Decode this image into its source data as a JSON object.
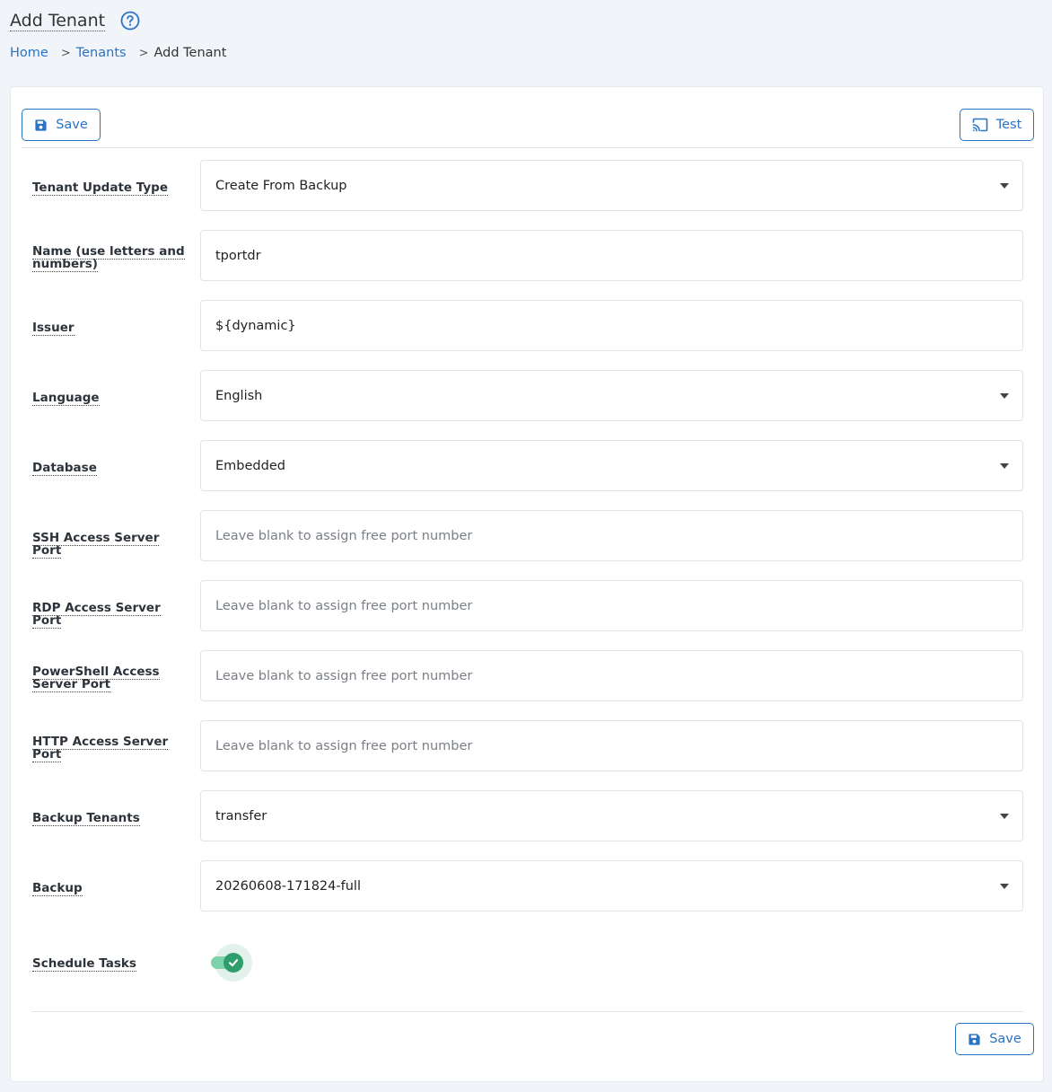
{
  "header": {
    "title": "Add Tenant",
    "help_icon": "question-circle-icon"
  },
  "breadcrumb": {
    "home": "Home",
    "sep": ">",
    "tenants": "Tenants",
    "current": "Add Tenant"
  },
  "toolbar": {
    "save_label": "Save",
    "test_label": "Test",
    "save_icon": "floppy-disk-icon",
    "test_icon": "cast-icon"
  },
  "form": {
    "tenant_update_type": {
      "label": "Tenant Update Type",
      "value": "Create From Backup"
    },
    "name": {
      "label": "Name (use letters and numbers)",
      "value": "tportdr"
    },
    "issuer": {
      "label": "Issuer",
      "value": "${dynamic}"
    },
    "language": {
      "label": "Language",
      "value": "English"
    },
    "database": {
      "label": "Database",
      "value": "Embedded"
    },
    "ssh_port": {
      "label": "SSH Access Server Port",
      "value": "",
      "placeholder": "Leave blank to assign free port number"
    },
    "rdp_port": {
      "label": "RDP Access Server Port",
      "value": "",
      "placeholder": "Leave blank to assign free port number"
    },
    "powershell_port": {
      "label": "PowerShell Access Server Port",
      "value": "",
      "placeholder": "Leave blank to assign free port number"
    },
    "http_port": {
      "label": "HTTP Access Server Port",
      "value": "",
      "placeholder": "Leave blank to assign free port number"
    },
    "backup_tenants": {
      "label": "Backup Tenants",
      "value": "transfer"
    },
    "backup": {
      "label": "Backup",
      "value": "20260608-171824-full"
    },
    "schedule_tasks": {
      "label": "Schedule Tasks",
      "enabled": true
    }
  },
  "footer": {
    "save_label": "Save"
  },
  "colors": {
    "accent": "#2a73c5",
    "toggle_on": "#2e9e6c",
    "page_bg": "#f1f4f9"
  }
}
